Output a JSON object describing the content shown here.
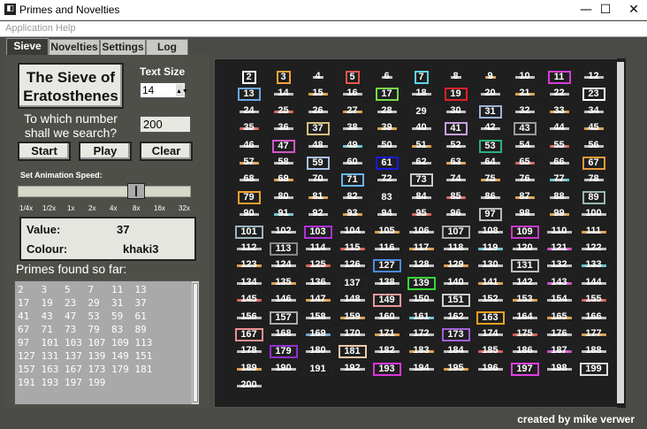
{
  "window": {
    "title": "Primes and Novelties",
    "minimize": "—",
    "maximize": "☐",
    "close": "✕"
  },
  "menu": [
    "Application",
    "Help"
  ],
  "tabs": [
    "Sieve",
    "Novelties",
    "Settings",
    "Log"
  ],
  "sieve": {
    "title_line1": "The Sieve of",
    "title_line2": "Eratosthenes",
    "text_size_label": "Text Size",
    "text_size_value": "14",
    "question_line1": "To which number",
    "question_line2": "shall we search?",
    "search_value": "200",
    "start_label": "Start",
    "play_label": "Play",
    "clear_label": "Clear",
    "speed_label": "Set Animation Speed:",
    "speed_ticks": [
      "1/4x",
      "1/2x",
      "1x",
      "2x",
      "4x",
      "8x",
      "16x",
      "32x"
    ],
    "speed_selected": "8x",
    "value_label": "Value:",
    "value": "37",
    "colour_label": "Colour:",
    "colour": "khaki3",
    "primes_found_label": "Primes found so far:",
    "primes_rows": [
      "2   3   5   7   11  13",
      "17  19  23  29  31  37",
      "41  43  47  53  59  61",
      "67  71  73  79  83  89",
      "97  101 103 107 109 113",
      "127 131 137 139 149 151",
      "157 163 167 173 179 181",
      "191 193 197 199"
    ]
  },
  "grid": {
    "max": 200,
    "primes": [
      2,
      3,
      5,
      7,
      11,
      13,
      17,
      19,
      23,
      29,
      31,
      37,
      41,
      43,
      47,
      53,
      59,
      61,
      67,
      71,
      73,
      79,
      83,
      89,
      97,
      101,
      103,
      107,
      109,
      113,
      127,
      131,
      137,
      139,
      149,
      151,
      157,
      163,
      167,
      173,
      179,
      181,
      191,
      193,
      197,
      199
    ],
    "prime_colors": {
      "2": "#ffffff",
      "3": "#f2a33a",
      "5": "#e8554a",
      "7": "#5fd3e6",
      "11": "#d63dd6",
      "13": "#6aa8e8",
      "17": "#7ad84a",
      "19": "#e0202a",
      "23": "#ffffff",
      "29": "#222222",
      "31": "#9ab4d8",
      "37": "#d6c07a",
      "41": "#c8a0e0",
      "43": "#9a9a9a",
      "47": "#d058c8",
      "53": "#2fb07a",
      "59": "#a8c0e8",
      "61": "#1a1ae0",
      "67": "#e89a3a",
      "71": "#6ab4e8",
      "73": "#c8c8c8",
      "79": "#f0a030",
      "83": "#222222",
      "89": "#9ab8b0",
      "97": "#bbbbbb",
      "101": "#9ab4c0",
      "103": "#b030d8",
      "107": "#aaaaaa",
      "109": "#c838c8",
      "113": "#888888",
      "127": "#4a8ae8",
      "131": "#bbbbbb",
      "137": "#222222",
      "139": "#38d838",
      "149": "#e89898",
      "151": "#cccccc",
      "157": "#aaaaaa",
      "163": "#f0a020",
      "167": "#f09090",
      "173": "#a060d8",
      "179": "#9030d0",
      "181": "#f0c8a8",
      "191": "#222222",
      "193": "#d838d8",
      "197": "#e040e0",
      "199": "#dddddd"
    },
    "strike_colors": {
      "2": "#cccccc",
      "3": "#f2a33a",
      "5": "#e8554a",
      "7": "#5fd3e6",
      "11": "#d63dd6",
      "13": "#6aa8e8"
    }
  },
  "footer": {
    "credit": "created by mike verwer"
  }
}
